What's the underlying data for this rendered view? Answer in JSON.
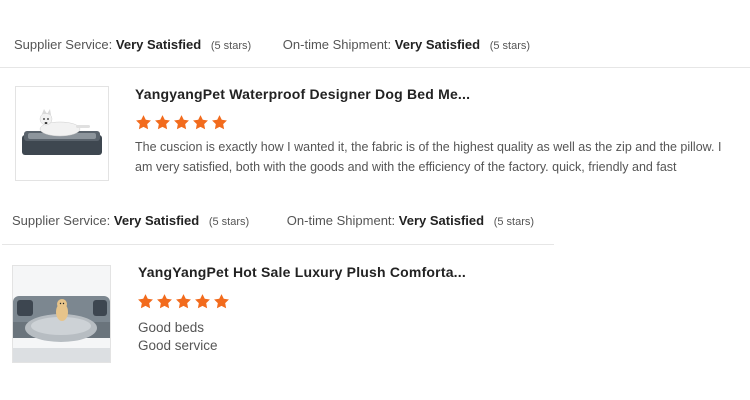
{
  "ratings_1": {
    "supplier_label": "Supplier Service:",
    "supplier_value": "Very Satisfied",
    "supplier_stars": "(5 stars)",
    "shipment_label": "On-time Shipment:",
    "shipment_value": "Very Satisfied",
    "shipment_stars": "(5 stars)"
  },
  "review_1": {
    "title": "YangyangPet Waterproof Designer Dog Bed Me...",
    "star_count": 5,
    "text": "The cuscion is exactly how I wanted it, the fabric is of the highest quality as well as the zip and the pillow. I am very satisfied, both with the goods and with the efficiency of the factory. quick, friendly and fast"
  },
  "ratings_2": {
    "supplier_label": "Supplier Service:",
    "supplier_value": "Very Satisfied",
    "supplier_stars": "(5 stars)",
    "shipment_label": "On-time Shipment:",
    "shipment_value": "Very Satisfied",
    "shipment_stars": "(5 stars)"
  },
  "review_2": {
    "title": "YangYangPet Hot Sale Luxury Plush Comforta...",
    "star_count": 5,
    "line1": "Good beds",
    "line2": "Good service"
  },
  "colors": {
    "star": "#f26b1d",
    "divider": "#e6e6e6"
  }
}
